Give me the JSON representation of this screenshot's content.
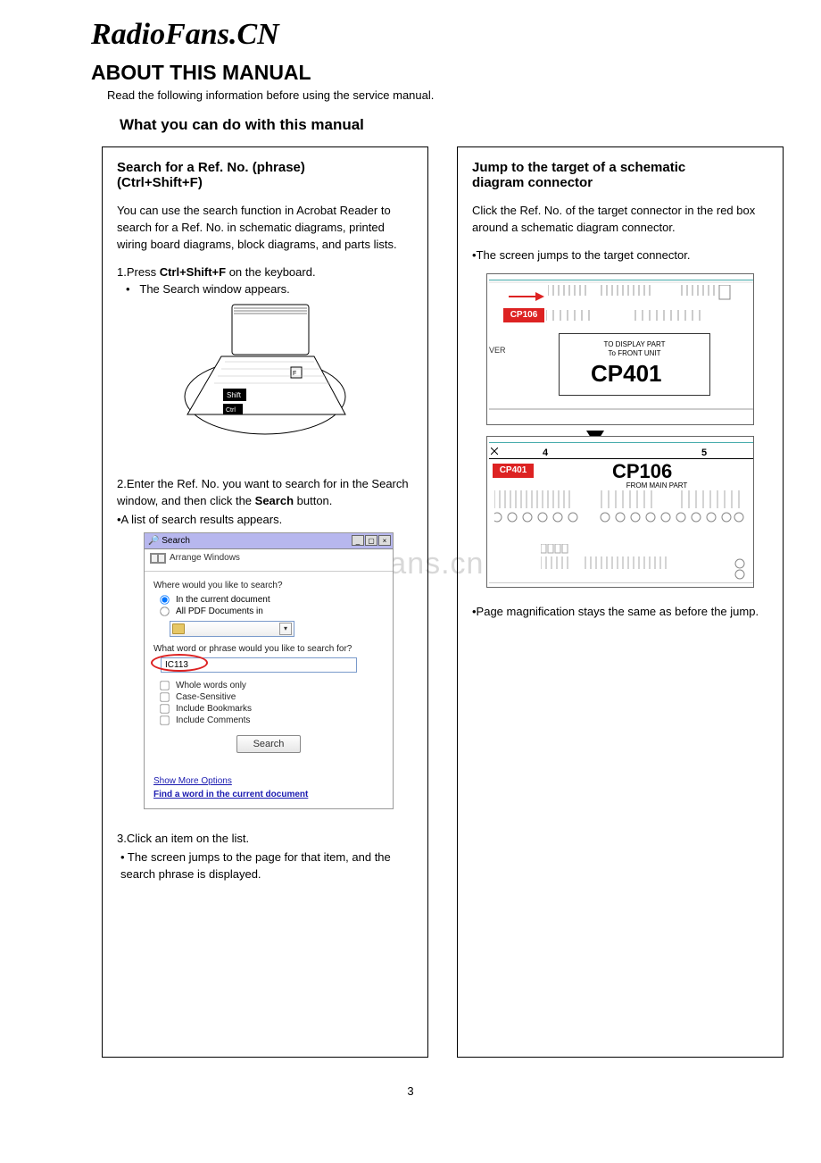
{
  "site_name": "RadioFans.CN",
  "watermark": "www.radiofans.cn",
  "page_number": "3",
  "headings": {
    "about": "ABOUT THIS MANUAL",
    "read_following": "Read the following information before using the service manual.",
    "what_you_can": "What you can do with this manual"
  },
  "left_panel": {
    "title_line1": "Search for a Ref. No. (phrase)",
    "title_line2": "(Ctrl+Shift+F)",
    "intro": "You can use the search function in Acrobat Reader to search for a Ref. No. in schematic diagrams, printed wiring board diagrams, block diagrams, and parts lists.",
    "step1_pre": "1.Press ",
    "step1_bold": "Ctrl+Shift+F",
    "step1_post": " on the keyboard.",
    "step1_bullet": "The Search window appears.",
    "laptop_keys": {
      "shift": "Shift",
      "ctrl": "Ctrl"
    },
    "step2_pre": "2.Enter the Ref. No. you want to search for in the Search window, and then click the ",
    "step2_bold": "Search",
    "step2_post": " button.",
    "step2_bullet": "•A list of search results appears.",
    "step3": "3.Click an item on the list.",
    "step3_bullet": "• The screen jumps to the page for that item, and the search phrase is displayed."
  },
  "search_window": {
    "title": "Search",
    "arrange_windows": "Arrange Windows",
    "where_label": "Where would you like to search?",
    "radio_current": "In the current document",
    "radio_all": "All PDF Documents in",
    "what_label": "What word or phrase would you like to search for?",
    "input_value": "IC113",
    "chk_whole": "Whole words only",
    "chk_case": "Case-Sensitive",
    "chk_bookmarks": "Include Bookmarks",
    "chk_comments": "Include Comments",
    "btn_search": "Search",
    "show_more": "Show More Options",
    "find_word": "Find a word in the current document"
  },
  "right_panel": {
    "title_line1": "Jump to the target of a schematic",
    "title_line2": "diagram connector",
    "intro": "Click the Ref. No. of the target connector in the red box around a schematic diagram connector.",
    "bullet1": "•The screen jumps to the target connector.",
    "diagram": {
      "cp106": "CP106",
      "cp401": "CP401",
      "cp401_big": "CP401",
      "cp401_sub1": "TO DISPLAY PART",
      "cp401_sub2": "To FRONT UNIT",
      "cp106_big": "CP106",
      "cp106_sub": "FROM MAIN PART",
      "axis4": "4",
      "axis5": "5",
      "ver": "VER"
    },
    "bullet2": "•Page magnification stays the same as before the jump."
  }
}
